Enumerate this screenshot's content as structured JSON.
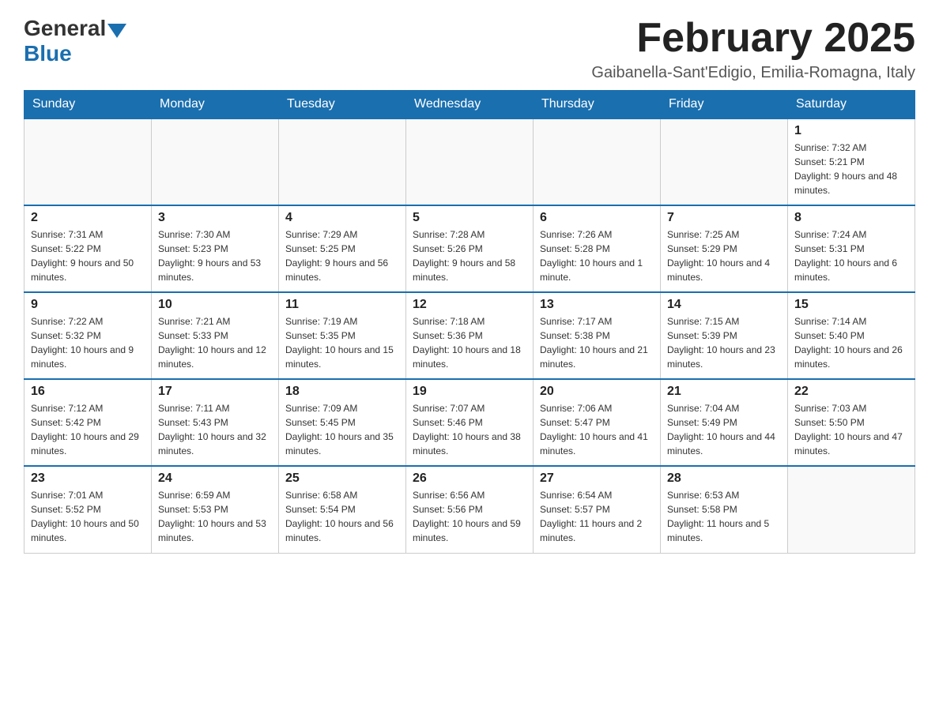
{
  "header": {
    "logo_general": "General",
    "logo_blue": "Blue",
    "month_title": "February 2025",
    "location": "Gaibanella-Sant'Edigio, Emilia-Romagna, Italy"
  },
  "weekdays": [
    "Sunday",
    "Monday",
    "Tuesday",
    "Wednesday",
    "Thursday",
    "Friday",
    "Saturday"
  ],
  "weeks": [
    [
      {
        "day": "",
        "sunrise": "",
        "sunset": "",
        "daylight": ""
      },
      {
        "day": "",
        "sunrise": "",
        "sunset": "",
        "daylight": ""
      },
      {
        "day": "",
        "sunrise": "",
        "sunset": "",
        "daylight": ""
      },
      {
        "day": "",
        "sunrise": "",
        "sunset": "",
        "daylight": ""
      },
      {
        "day": "",
        "sunrise": "",
        "sunset": "",
        "daylight": ""
      },
      {
        "day": "",
        "sunrise": "",
        "sunset": "",
        "daylight": ""
      },
      {
        "day": "1",
        "sunrise": "Sunrise: 7:32 AM",
        "sunset": "Sunset: 5:21 PM",
        "daylight": "Daylight: 9 hours and 48 minutes."
      }
    ],
    [
      {
        "day": "2",
        "sunrise": "Sunrise: 7:31 AM",
        "sunset": "Sunset: 5:22 PM",
        "daylight": "Daylight: 9 hours and 50 minutes."
      },
      {
        "day": "3",
        "sunrise": "Sunrise: 7:30 AM",
        "sunset": "Sunset: 5:23 PM",
        "daylight": "Daylight: 9 hours and 53 minutes."
      },
      {
        "day": "4",
        "sunrise": "Sunrise: 7:29 AM",
        "sunset": "Sunset: 5:25 PM",
        "daylight": "Daylight: 9 hours and 56 minutes."
      },
      {
        "day": "5",
        "sunrise": "Sunrise: 7:28 AM",
        "sunset": "Sunset: 5:26 PM",
        "daylight": "Daylight: 9 hours and 58 minutes."
      },
      {
        "day": "6",
        "sunrise": "Sunrise: 7:26 AM",
        "sunset": "Sunset: 5:28 PM",
        "daylight": "Daylight: 10 hours and 1 minute."
      },
      {
        "day": "7",
        "sunrise": "Sunrise: 7:25 AM",
        "sunset": "Sunset: 5:29 PM",
        "daylight": "Daylight: 10 hours and 4 minutes."
      },
      {
        "day": "8",
        "sunrise": "Sunrise: 7:24 AM",
        "sunset": "Sunset: 5:31 PM",
        "daylight": "Daylight: 10 hours and 6 minutes."
      }
    ],
    [
      {
        "day": "9",
        "sunrise": "Sunrise: 7:22 AM",
        "sunset": "Sunset: 5:32 PM",
        "daylight": "Daylight: 10 hours and 9 minutes."
      },
      {
        "day": "10",
        "sunrise": "Sunrise: 7:21 AM",
        "sunset": "Sunset: 5:33 PM",
        "daylight": "Daylight: 10 hours and 12 minutes."
      },
      {
        "day": "11",
        "sunrise": "Sunrise: 7:19 AM",
        "sunset": "Sunset: 5:35 PM",
        "daylight": "Daylight: 10 hours and 15 minutes."
      },
      {
        "day": "12",
        "sunrise": "Sunrise: 7:18 AM",
        "sunset": "Sunset: 5:36 PM",
        "daylight": "Daylight: 10 hours and 18 minutes."
      },
      {
        "day": "13",
        "sunrise": "Sunrise: 7:17 AM",
        "sunset": "Sunset: 5:38 PM",
        "daylight": "Daylight: 10 hours and 21 minutes."
      },
      {
        "day": "14",
        "sunrise": "Sunrise: 7:15 AM",
        "sunset": "Sunset: 5:39 PM",
        "daylight": "Daylight: 10 hours and 23 minutes."
      },
      {
        "day": "15",
        "sunrise": "Sunrise: 7:14 AM",
        "sunset": "Sunset: 5:40 PM",
        "daylight": "Daylight: 10 hours and 26 minutes."
      }
    ],
    [
      {
        "day": "16",
        "sunrise": "Sunrise: 7:12 AM",
        "sunset": "Sunset: 5:42 PM",
        "daylight": "Daylight: 10 hours and 29 minutes."
      },
      {
        "day": "17",
        "sunrise": "Sunrise: 7:11 AM",
        "sunset": "Sunset: 5:43 PM",
        "daylight": "Daylight: 10 hours and 32 minutes."
      },
      {
        "day": "18",
        "sunrise": "Sunrise: 7:09 AM",
        "sunset": "Sunset: 5:45 PM",
        "daylight": "Daylight: 10 hours and 35 minutes."
      },
      {
        "day": "19",
        "sunrise": "Sunrise: 7:07 AM",
        "sunset": "Sunset: 5:46 PM",
        "daylight": "Daylight: 10 hours and 38 minutes."
      },
      {
        "day": "20",
        "sunrise": "Sunrise: 7:06 AM",
        "sunset": "Sunset: 5:47 PM",
        "daylight": "Daylight: 10 hours and 41 minutes."
      },
      {
        "day": "21",
        "sunrise": "Sunrise: 7:04 AM",
        "sunset": "Sunset: 5:49 PM",
        "daylight": "Daylight: 10 hours and 44 minutes."
      },
      {
        "day": "22",
        "sunrise": "Sunrise: 7:03 AM",
        "sunset": "Sunset: 5:50 PM",
        "daylight": "Daylight: 10 hours and 47 minutes."
      }
    ],
    [
      {
        "day": "23",
        "sunrise": "Sunrise: 7:01 AM",
        "sunset": "Sunset: 5:52 PM",
        "daylight": "Daylight: 10 hours and 50 minutes."
      },
      {
        "day": "24",
        "sunrise": "Sunrise: 6:59 AM",
        "sunset": "Sunset: 5:53 PM",
        "daylight": "Daylight: 10 hours and 53 minutes."
      },
      {
        "day": "25",
        "sunrise": "Sunrise: 6:58 AM",
        "sunset": "Sunset: 5:54 PM",
        "daylight": "Daylight: 10 hours and 56 minutes."
      },
      {
        "day": "26",
        "sunrise": "Sunrise: 6:56 AM",
        "sunset": "Sunset: 5:56 PM",
        "daylight": "Daylight: 10 hours and 59 minutes."
      },
      {
        "day": "27",
        "sunrise": "Sunrise: 6:54 AM",
        "sunset": "Sunset: 5:57 PM",
        "daylight": "Daylight: 11 hours and 2 minutes."
      },
      {
        "day": "28",
        "sunrise": "Sunrise: 6:53 AM",
        "sunset": "Sunset: 5:58 PM",
        "daylight": "Daylight: 11 hours and 5 minutes."
      },
      {
        "day": "",
        "sunrise": "",
        "sunset": "",
        "daylight": ""
      }
    ]
  ]
}
